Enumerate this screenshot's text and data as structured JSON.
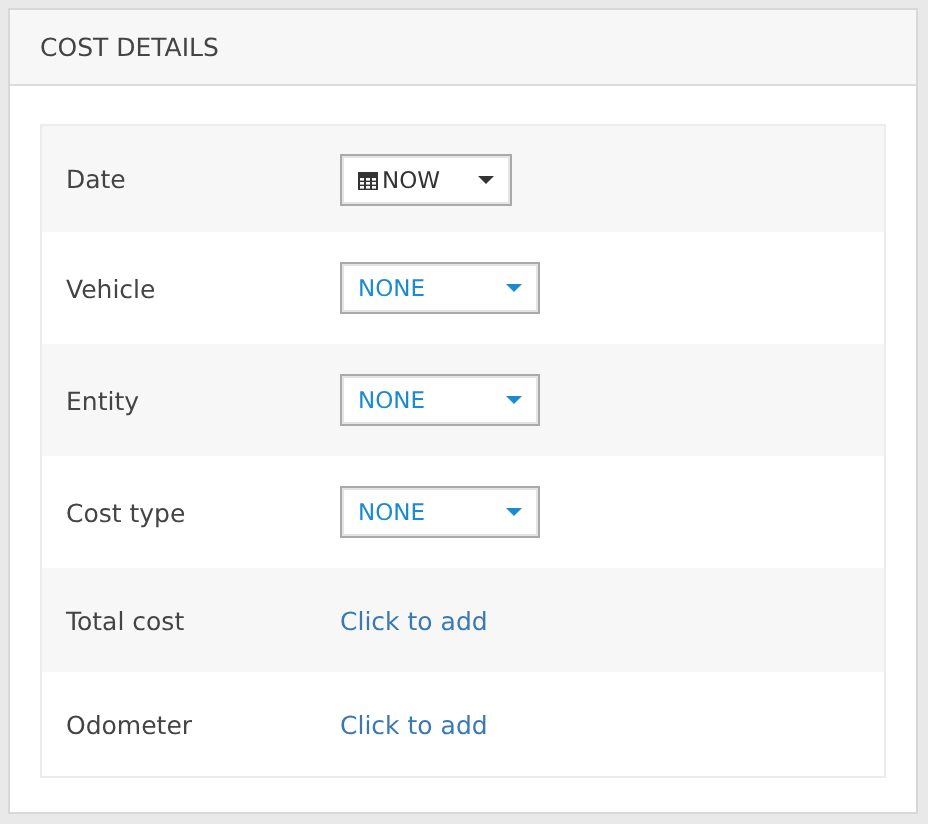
{
  "panel": {
    "title": "COST DETAILS"
  },
  "rows": [
    {
      "label": "Date",
      "kind": "date",
      "value": "NOW"
    },
    {
      "label": "Vehicle",
      "kind": "dropdown",
      "value": "NONE"
    },
    {
      "label": "Entity",
      "kind": "dropdown",
      "value": "NONE"
    },
    {
      "label": "Cost type",
      "kind": "dropdown",
      "value": "NONE"
    },
    {
      "label": "Total cost",
      "kind": "link",
      "value": "Click to add"
    },
    {
      "label": "Odometer",
      "kind": "link",
      "value": "Click to add"
    }
  ]
}
